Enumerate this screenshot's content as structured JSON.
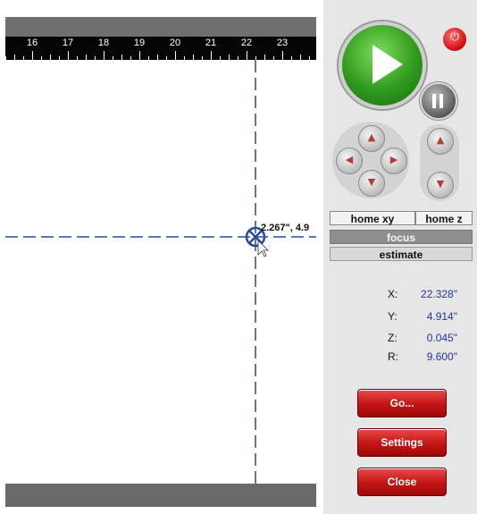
{
  "ruler": {
    "labels": [
      "16",
      "17",
      "18",
      "19",
      "20",
      "21",
      "22",
      "23"
    ]
  },
  "canvas": {
    "cursor_label": "2.267\", 4.9"
  },
  "controls": {
    "play_icon": "play-icon",
    "pause_icon": "pause-icon",
    "power_icon": "power-icon",
    "power_glyph": "⏻",
    "up_glyph": "▲",
    "down_glyph": "▼",
    "left_glyph": "◀",
    "right_glyph": "▶"
  },
  "buttons": {
    "home_xy": "home xy",
    "home_z": "home z",
    "focus": "focus",
    "estimate": "estimate",
    "go": "Go...",
    "settings": "Settings",
    "close": "Close"
  },
  "readout": {
    "x_label": "X:",
    "x_value": "22.328\"",
    "y_label": "Y:",
    "y_value": "4.914\"",
    "z_label": "Z:",
    "z_value": "0.045\"",
    "r_label": "R:",
    "r_value": "9.600\""
  },
  "colors": {
    "play_green": "#2f9a1e",
    "power_red": "#d41010",
    "action_red": "#c41414",
    "readout_blue": "#2233aa",
    "crosshair_blue": "#2a4aa0"
  }
}
